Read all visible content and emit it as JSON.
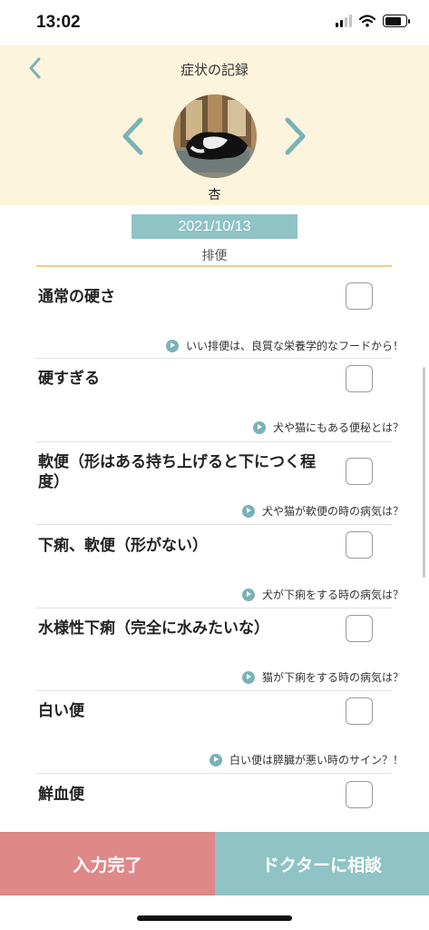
{
  "status_bar": {
    "time": "13:02"
  },
  "header": {
    "title": "症状の記録",
    "pet_name": "杏"
  },
  "record": {
    "date": "2021/10/13",
    "category": "排便"
  },
  "items": [
    {
      "label": "通常の硬さ",
      "link": "いい排便は、良質な栄養学的なフードから！"
    },
    {
      "label": "硬すぎる",
      "link": "犬や猫にもある便秘とは？"
    },
    {
      "label": "軟便（形はある持ち上げると下につく程度）",
      "link": "犬や猫が軟便の時の病気は？"
    },
    {
      "label": "下痢、軟便（形がない）",
      "link": "犬が下痢をする時の病気は？"
    },
    {
      "label": "水様性下痢（完全に水みたいな）",
      "link": "猫が下痢をする時の病気は？"
    },
    {
      "label": "白い便",
      "link": "白い便は膵臓が悪い時のサイン？！"
    },
    {
      "label": "鮮血便"
    }
  ],
  "buttons": {
    "complete": "入力完了",
    "consult": "ドクターに相談"
  },
  "colors": {
    "header_bg": "#fdf4dd",
    "accent_teal": "#8fc3c5",
    "accent_red": "#de8888",
    "underline": "#f3cb87"
  },
  "icons": [
    "back-chevron-icon",
    "prev-pet-chevron-icon",
    "next-pet-chevron-icon",
    "play-icon",
    "signal-icon",
    "wifi-icon",
    "battery-icon"
  ]
}
